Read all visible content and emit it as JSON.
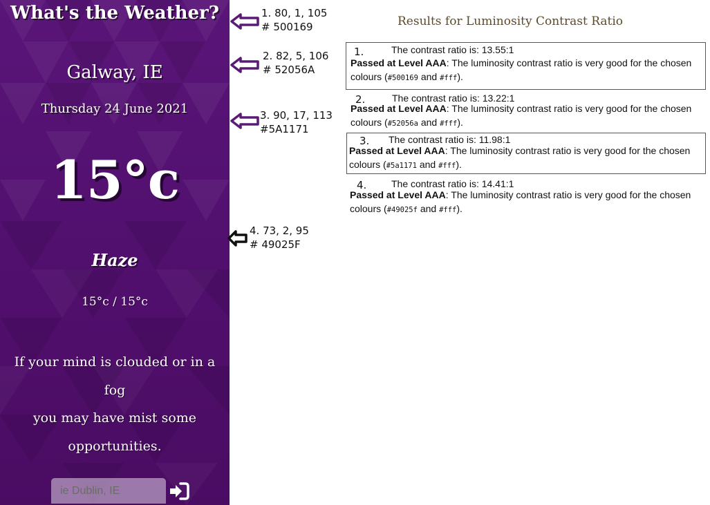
{
  "weather": {
    "app_title": "What's the Weather?",
    "location": "Galway, IE",
    "date": "Thursday 24 June 2021",
    "temperature": "15°c",
    "condition": "Haze",
    "min_max": "15°c / 15°c",
    "quote_lines": [
      "If your mind is clouded or in a fog",
      "you may have mist some",
      "opportunities."
    ],
    "search_placeholder": "ie Dublin, IE",
    "submit_icon": "sign-in-icon",
    "panel_colors": [
      "#500169",
      "#52056A",
      "#5A1171",
      "#49025F"
    ]
  },
  "annotations": [
    {
      "line1": "1. 80, 1, 105",
      "line2": "# 500169",
      "arrow_color": "#5a1a78"
    },
    {
      "line1": "2. 82, 5, 106",
      "line2": "# 52056A",
      "arrow_color": "#5a1a78"
    },
    {
      "line1": "3. 90, 17, 113",
      "line2": "#5A1171",
      "arrow_color": "#5a1a78"
    },
    {
      "line1": "4. 73, 2, 95",
      "line2": "# 49025F",
      "arrow_color": "#111111"
    }
  ],
  "results": {
    "title": "Results for Luminosity Contrast Ratio",
    "passed_label": "Passed at Level AAA",
    "passed_text": ": The luminosity contrast ratio is very good for the chosen",
    "colours_word": "colours (",
    "and_word": " and ",
    "close_text": ").",
    "foreground": "#fff",
    "items": [
      {
        "number": "1.",
        "ratio_text": "The contrast ratio is: 13.55:1",
        "background": "#500169"
      },
      {
        "number": "2.",
        "ratio_text": "The contrast ratio is: 13.22:1",
        "background": "#52056a"
      },
      {
        "number": "3.",
        "ratio_text": "The contrast ratio is: 11.98:1",
        "background": "#5a1171"
      },
      {
        "number": "4.",
        "ratio_text": "The contrast ratio is: 14.41:1",
        "background": "#49025f"
      }
    ]
  }
}
